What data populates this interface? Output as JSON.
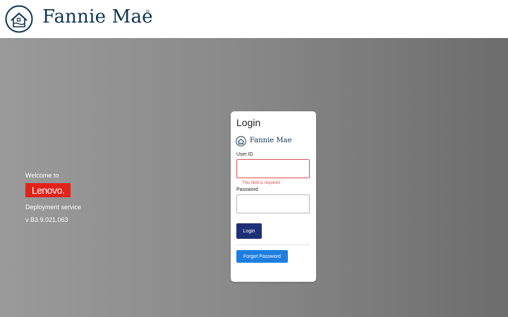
{
  "header": {
    "brand_name": "Fannie Mae",
    "brand_reg": "®",
    "logo_icon": "house-in-circle-icon"
  },
  "welcome": {
    "welcome_text": "Welcome to",
    "lenovo_label": "Lenovo.",
    "service_text": "Deployment service",
    "version_text": "v B3.9.021.063"
  },
  "login": {
    "title": "Login",
    "brand_name": "Fannie Mae",
    "userid_label": "User ID",
    "userid_value": "",
    "userid_error": "This field is required",
    "password_label": "Password",
    "password_value": "",
    "login_button": "Login",
    "forgot_button": "Forgot Password"
  },
  "colors": {
    "brand_navy": "#0e3452",
    "lenovo_red": "#e2231a",
    "error_red": "#d9534f",
    "login_button": "#1e2f78",
    "forgot_button": "#1e7ee0"
  }
}
